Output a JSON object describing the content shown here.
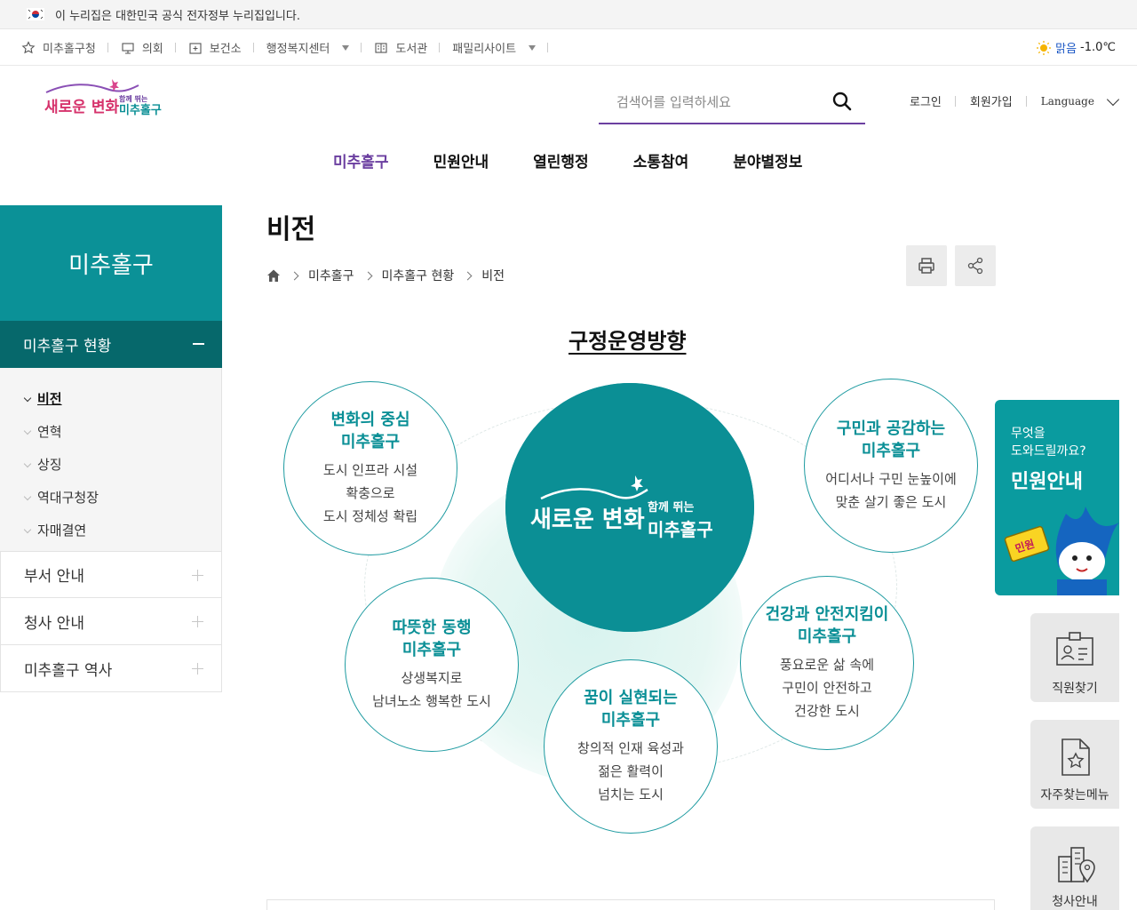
{
  "gov_banner": {
    "text": "이 누리집은 대한민국 공식 전자정부 누리집입니다."
  },
  "util_bar": {
    "items": [
      {
        "label": "미추홀구청",
        "icon": "star-icon"
      },
      {
        "label": "의회",
        "icon": "podium-icon"
      },
      {
        "label": "보건소",
        "icon": "hospital-icon"
      },
      {
        "label": "행정복지센터",
        "icon": "",
        "dropdown": true
      },
      {
        "label": "도서관",
        "icon": "book-icon"
      },
      {
        "label": "패밀리사이트",
        "icon": "",
        "dropdown": true
      }
    ],
    "weather": {
      "status": "맑음",
      "temp": "-1.0℃",
      "icon": "sun-icon"
    }
  },
  "header": {
    "logo": {
      "line1": "새로운 변화",
      "line2": "함께 뛰는",
      "line3": "미추홀구"
    },
    "search": {
      "placeholder": "검색어를 입력하세요",
      "value": ""
    },
    "auth": {
      "login": "로그인",
      "signup": "회원가입",
      "language": "Language"
    }
  },
  "gnb": {
    "items": [
      {
        "label": "미추홀구",
        "active": true
      },
      {
        "label": "민원안내"
      },
      {
        "label": "열린행정"
      },
      {
        "label": "소통참여"
      },
      {
        "label": "분야별정보"
      }
    ]
  },
  "sidebar": {
    "title": "미추홀구",
    "open_group": "미추홀구 현황",
    "sub_items": [
      "비전",
      "연혁",
      "상징",
      "역대구청장",
      "자매결연"
    ],
    "active_sub": "비전",
    "groups": [
      "부서 안내",
      "청사 안내",
      "미추홀구 역사"
    ]
  },
  "content": {
    "page_title": "비전",
    "breadcrumb": [
      "미추홀구",
      "미추홀구 현황",
      "비전"
    ],
    "section_title": "구정운영방향",
    "center": {
      "line1": "새로운 변화",
      "line2": "함께 뛰는",
      "line3": "미추홀구"
    },
    "nodes": [
      {
        "title1": "변화의 중심",
        "title2": "미추홀구",
        "desc": [
          "도시 인프라 시설",
          "확충으로",
          "도시 정체성 확립"
        ]
      },
      {
        "title1": "구민과 공감하는",
        "title2": "미추홀구",
        "desc": [
          "어디서나 구민 눈높이에",
          "맞춘 살기 좋은 도시"
        ]
      },
      {
        "title1": "따뜻한 동행",
        "title2": "미추홀구",
        "desc": [
          "상생복지로",
          "남녀노소 행복한 도시"
        ]
      },
      {
        "title1": "건강과 안전지킴이",
        "title2": "미추홀구",
        "desc": [
          "풍요로운 삶 속에",
          "구민이 안전하고",
          "건강한 도시"
        ]
      },
      {
        "title1": "꿈이 실현되는",
        "title2": "미추홀구",
        "desc": [
          "창의적 인재 육성과",
          "젊은 활력이",
          "넘치는 도시"
        ]
      }
    ]
  },
  "quick_menu": {
    "minwon": {
      "question1": "무엇을",
      "question2": "도와드릴까요?",
      "title": "민원안내",
      "badge": "민원"
    },
    "items": [
      {
        "label": "직원찾기",
        "icon": "id-card-icon"
      },
      {
        "label": "자주찾는메뉴",
        "icon": "star-document-icon"
      },
      {
        "label": "청사안내",
        "icon": "building-location-icon"
      }
    ]
  },
  "colors": {
    "teal": "#0b9197",
    "dark_teal": "#06686b",
    "purple": "#6b3fa0",
    "node_title": "#0a8f96"
  }
}
